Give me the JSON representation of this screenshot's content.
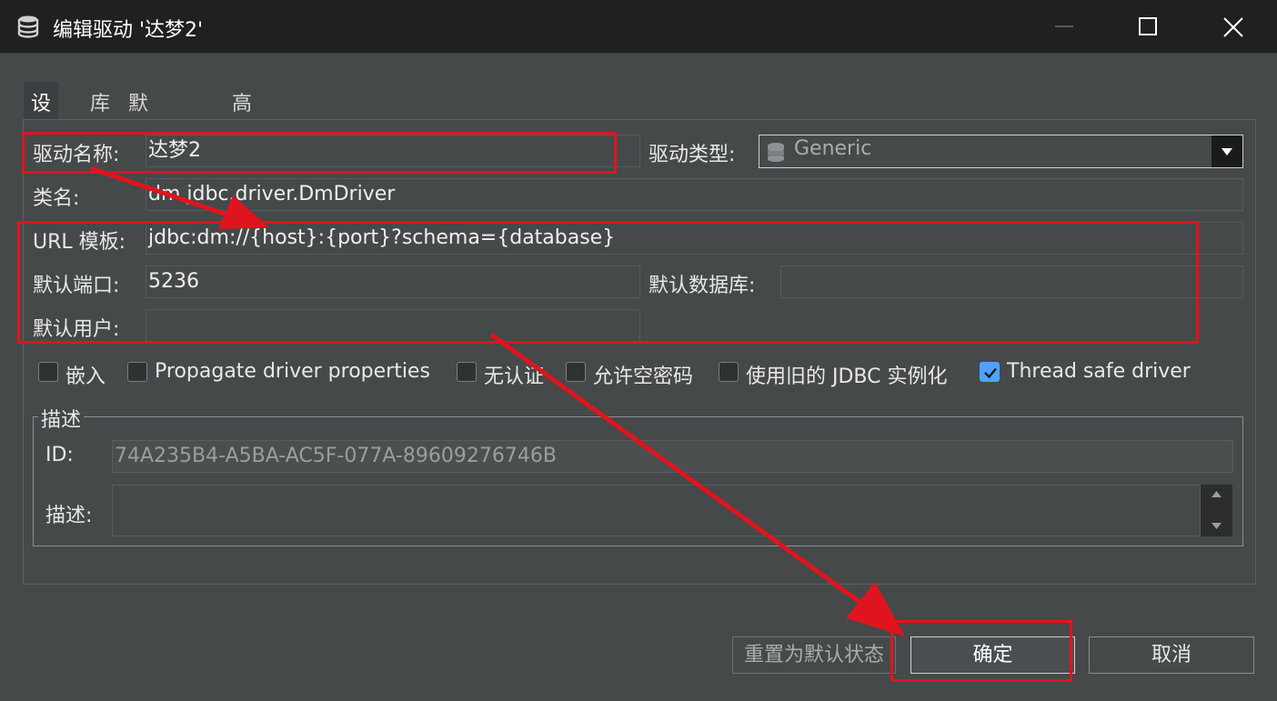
{
  "window": {
    "title": "编辑驱动 '达梦2'"
  },
  "tabs": [
    "设置",
    "库",
    "默认属性",
    "高级参数"
  ],
  "settings": {
    "driver_name_label": "驱动名称:",
    "driver_name_value": "达梦2",
    "driver_type_label": "驱动类型:",
    "driver_type_value": "Generic",
    "class_name_label": "类名:",
    "class_name_value": "dm.jdbc.driver.DmDriver",
    "url_template_label": "URL 模板:",
    "url_template_value": "jdbc:dm://{host}:{port}?schema={database}",
    "default_port_label": "默认端口:",
    "default_port_value": "5236",
    "default_database_label": "默认数据库:",
    "default_database_value": "",
    "default_user_label": "默认用户:",
    "default_user_value": ""
  },
  "checkboxes": [
    {
      "label": "嵌入",
      "checked": false
    },
    {
      "label": "Propagate driver properties",
      "checked": false
    },
    {
      "label": "无认证",
      "checked": false
    },
    {
      "label": "允许空密码",
      "checked": false
    },
    {
      "label": "使用旧的 JDBC 实例化",
      "checked": false
    },
    {
      "label": "Thread safe driver",
      "checked": true
    }
  ],
  "description": {
    "group_title": "描述",
    "id_label": "ID:",
    "id_value": "74A235B4-A5BA-AC5F-077A-89609276746B",
    "desc_label": "描述:",
    "desc_value": ""
  },
  "buttons": {
    "reset": "重置为默认状态",
    "ok": "确定",
    "cancel": "取消"
  },
  "colors": {
    "annotation": "#e0141e",
    "checkbox_checked": "#4da3ff"
  }
}
